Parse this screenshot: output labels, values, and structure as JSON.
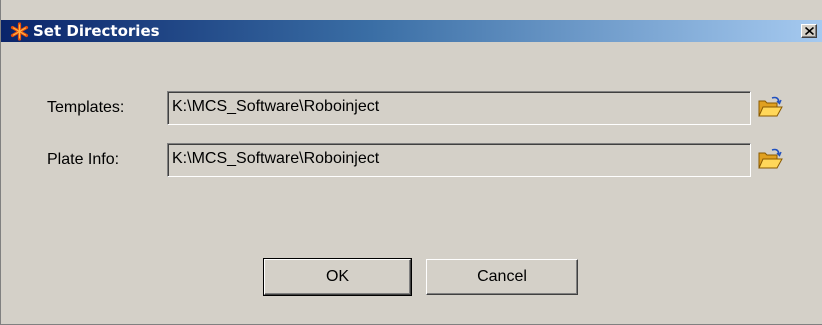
{
  "window": {
    "title": "Set Directories",
    "title_icon": "star-app-icon",
    "close_icon": "close-icon"
  },
  "fields": [
    {
      "label": "Templates:",
      "value": "K:\\MCS_Software\\Roboinject",
      "browse_icon": "folder-open-icon"
    },
    {
      "label": "Plate Info:",
      "value": "K:\\MCS_Software\\Roboinject",
      "browse_icon": "folder-open-icon"
    }
  ],
  "buttons": {
    "ok_label": "OK",
    "cancel_label": "Cancel"
  },
  "colors": {
    "titlebar_start": "#0a246a",
    "titlebar_end": "#a6caf0",
    "dialog_face": "#d4d0c8"
  }
}
